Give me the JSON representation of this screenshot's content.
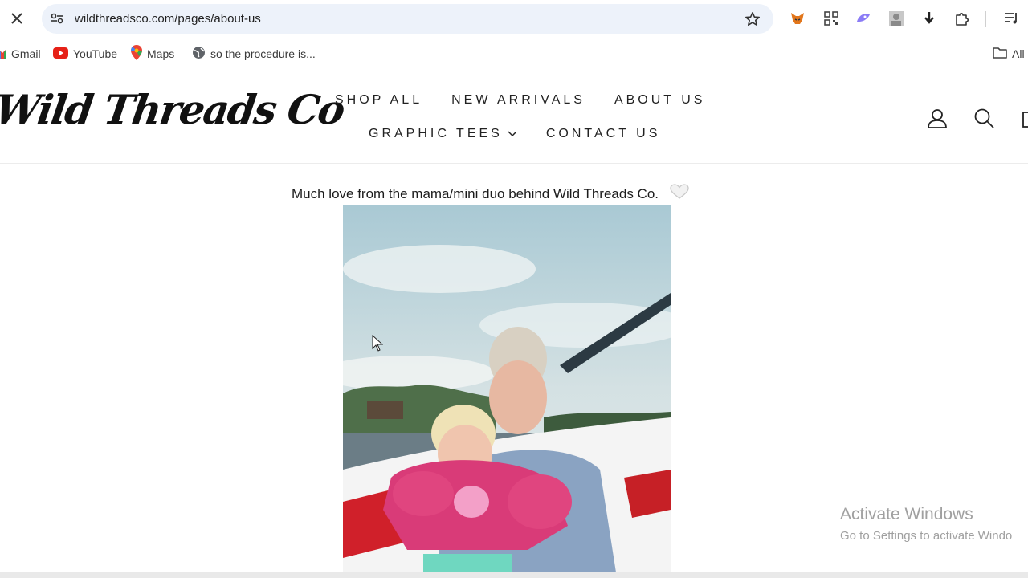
{
  "browser": {
    "url": "wildthreadsco.com/pages/about-us",
    "bookmarks": [
      {
        "label": "Gmail",
        "icon": "gmail-icon"
      },
      {
        "label": "YouTube",
        "icon": "youtube-icon"
      },
      {
        "label": "Maps",
        "icon": "maps-icon"
      },
      {
        "label": "so the procedure is...",
        "icon": "globe-icon"
      }
    ],
    "all_bookmarks_label": "All",
    "extensions": [
      "metamask-icon",
      "qr-code-icon",
      "ai-extension-icon",
      "profile-extension-icon",
      "download-icon",
      "puzzle-icon",
      "reading-list-icon"
    ]
  },
  "site": {
    "logo_text": "Wild Threads Co",
    "nav": {
      "row1": [
        "SHOP ALL",
        "NEW ARRIVALS",
        "ABOUT US"
      ],
      "graphic_tees": "GRAPHIC TEES",
      "contact": "CONTACT US"
    },
    "header_icons": [
      "account-icon",
      "search-icon",
      "cart-icon"
    ]
  },
  "content": {
    "intro_text": "Much love from the mama/mini duo behind Wild Threads Co.",
    "photo_alt": "heart-icon"
  },
  "watermark": {
    "title": "Activate Windows",
    "subtitle": "Go to Settings to activate Windo"
  }
}
